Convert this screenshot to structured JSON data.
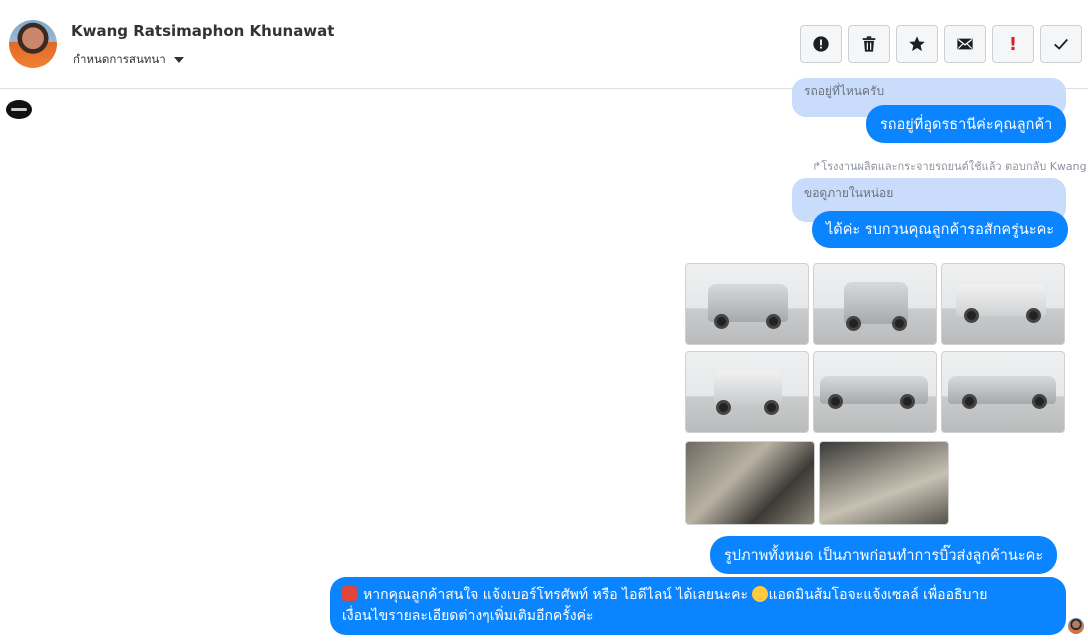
{
  "header": {
    "contact_name": "Kwang Ratsimaphon Khunawat",
    "label_select": "กำหนดการสนทนา"
  },
  "toolbar": {
    "icons": [
      "spam-icon",
      "trash-icon",
      "star-icon",
      "mail-icon",
      "important-icon",
      "check-icon"
    ],
    "important_glyph": "!"
  },
  "messages": {
    "quoted_1": "รถอยู่ที่ไหนครับ",
    "reply_1": "รถอยู่ที่อุดรธานีค่ะคุณลูกค้า",
    "reply_note": "↱โรงงานผลิตและกระจายรถยนต์ใช้แล้ว ตอบกลับ Kwang",
    "quoted_2": "ขอดูภายในหน่อย",
    "reply_2": "ได้ค่ะ รบกวนคุณลูกค้ารอสักครู่นะคะ",
    "caption": "รูปภาพทั้งหมด เป็นภาพก่อนทำการบิ๊วส่งลูกค้านะคะ",
    "contact_line_1": "หากคุณลูกค้าสนใจ แจ้งเบอร์โทรศัพท์ หรือ ไอดีไลน์  ได้เลยนะคะ",
    "contact_line_1b": "แอดมินส้มโอจะแจ้งเซลล์   เพื่ออธิบาย",
    "contact_line_2": "เงื่อนไขรายละเอียดต่างๆเพิ่มเติมอีกครั้งค่ะ"
  },
  "colors": {
    "bubble": "#0a84ff",
    "quoted": "#c9dcfb",
    "important": "#e02020"
  },
  "photos": [
    "front-left",
    "front",
    "rear-right",
    "rear",
    "side-left",
    "side-right",
    "interior-shifter",
    "interior-seats"
  ]
}
